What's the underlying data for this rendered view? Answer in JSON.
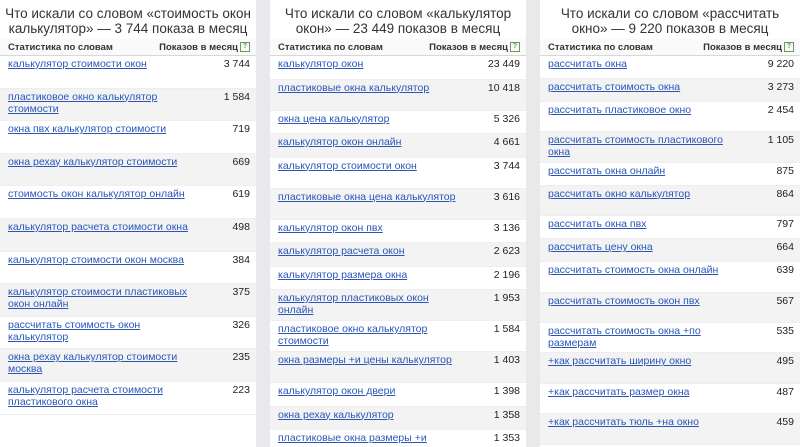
{
  "panels": [
    {
      "title": "Что искали со словом «стоимость окон калькулятор» — 3 744 показа в месяц",
      "col_keyword": "Статистика по словам",
      "col_count": "Показов в месяц",
      "rows": [
        {
          "kw": "калькулятор стоимости окон",
          "n": "3 744"
        },
        {
          "kw": "пластиковое окно калькулятор стоимости",
          "n": "1 584"
        },
        {
          "kw": "окна пвх калькулятор стоимости",
          "n": "719"
        },
        {
          "kw": "окна рехау калькулятор стоимости",
          "n": "669"
        },
        {
          "kw": "стоимость окон калькулятор онлайн",
          "n": "619"
        },
        {
          "kw": "калькулятор расчета стоимости окна",
          "n": "498"
        },
        {
          "kw": "калькулятор стоимости окон москва",
          "n": "384"
        },
        {
          "kw": "калькулятор стоимости пластиковых окон онлайн",
          "n": "375"
        },
        {
          "kw": "рассчитать стоимость окон калькулятор",
          "n": "326"
        },
        {
          "kw": "окна рехау калькулятор стоимости москва",
          "n": "235"
        },
        {
          "kw": "калькулятор расчета стоимости пластикового окна",
          "n": "223"
        }
      ]
    },
    {
      "title": "Что искали со словом «калькулятор окон» — 23 449 показов в месяц",
      "col_keyword": "Статистика по словам",
      "col_count": "Показов в месяц",
      "rows": [
        {
          "kw": "калькулятор окон",
          "n": "23 449"
        },
        {
          "kw": "пластиковые окна калькулятор",
          "n": "10 418"
        },
        {
          "kw": "окна цена калькулятор",
          "n": "5 326"
        },
        {
          "kw": "калькулятор окон онлайн",
          "n": "4 661"
        },
        {
          "kw": "калькулятор стоимости окон",
          "n": "3 744"
        },
        {
          "kw": "пластиковые окна цена калькулятор",
          "n": "3 616"
        },
        {
          "kw": "калькулятор окон пвх",
          "n": "3 136"
        },
        {
          "kw": "калькулятор расчета окон",
          "n": "2 623"
        },
        {
          "kw": "калькулятор размера окна",
          "n": "2 196"
        },
        {
          "kw": "калькулятор пластиковых окон онлайн",
          "n": "1 953"
        },
        {
          "kw": "пластиковое окно калькулятор стоимости",
          "n": "1 584"
        },
        {
          "kw": "окна размеры +и цены калькулятор",
          "n": "1 403"
        },
        {
          "kw": "калькулятор окон двери",
          "n": "1 398"
        },
        {
          "kw": "окна рехау калькулятор",
          "n": "1 358"
        },
        {
          "kw": "пластиковые окна размеры +и калькулятор",
          "n": "1 353"
        }
      ]
    },
    {
      "title": "Что искали со словом «рассчитать окно» — 9 220 показов в месяц",
      "col_keyword": "Статистика по словам",
      "col_count": "Показов в месяц",
      "rows": [
        {
          "kw": "рассчитать окна",
          "n": "9 220"
        },
        {
          "kw": "рассчитать стоимость окна",
          "n": "3 273"
        },
        {
          "kw": "рассчитать пластиковое окно",
          "n": "2 454"
        },
        {
          "kw": "рассчитать стоимость пластикового окна",
          "n": "1 105"
        },
        {
          "kw": "рассчитать окна онлайн",
          "n": "875"
        },
        {
          "kw": "рассчитать окно калькулятор",
          "n": "864"
        },
        {
          "kw": "рассчитать окна пвх",
          "n": "797"
        },
        {
          "kw": "рассчитать цену окна",
          "n": "664"
        },
        {
          "kw": "рассчитать стоимость окна онлайн",
          "n": "639"
        },
        {
          "kw": "рассчитать стоимость окон пвх",
          "n": "567"
        },
        {
          "kw": "рассчитать стоимость окна +по размерам",
          "n": "535"
        },
        {
          "kw": "+как рассчитать ширину окно",
          "n": "495"
        },
        {
          "kw": "+как рассчитать размер окна",
          "n": "487"
        },
        {
          "kw": "+как рассчитать тюль +на окно",
          "n": "459"
        }
      ]
    }
  ]
}
